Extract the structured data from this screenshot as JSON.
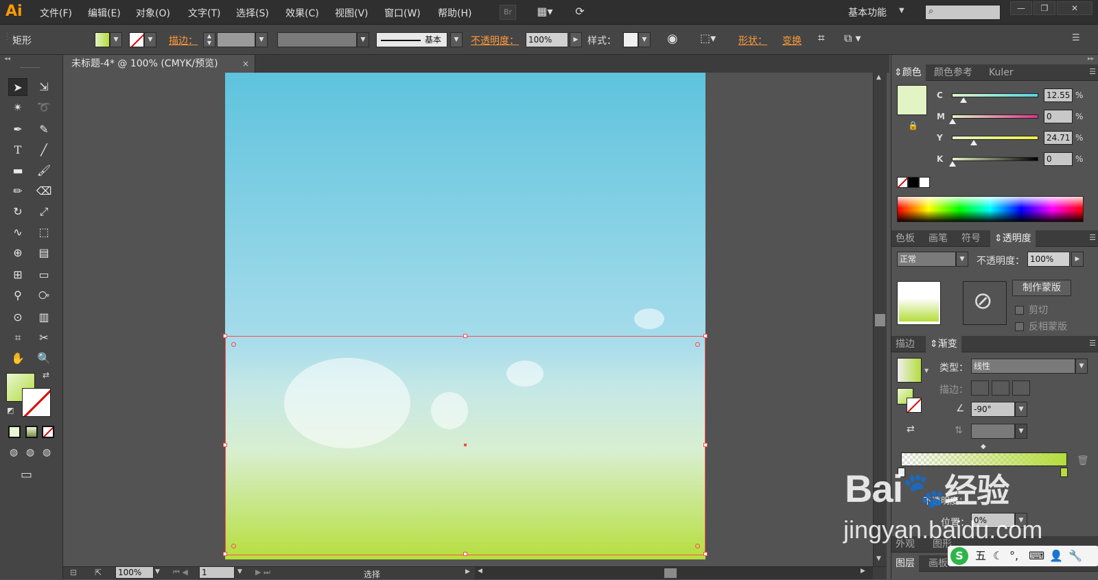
{
  "app": {
    "logo": "Ai",
    "menus": [
      "文件(F)",
      "编辑(E)",
      "对象(O)",
      "文字(T)",
      "选择(S)",
      "效果(C)",
      "视图(V)",
      "窗口(W)",
      "帮助(H)"
    ],
    "bridge_label": "Br",
    "workspace": "基本功能"
  },
  "controlbar": {
    "object_type": "矩形",
    "stroke_label": "描边：",
    "stroke_style": "基本",
    "opacity_label": "不透明度：",
    "opacity_value": "100%",
    "style_label": "样式：",
    "shape_label": "形状：",
    "transform_label": "变换"
  },
  "document": {
    "tab_title": "未标题-4* @ 100% (CMYK/预览)",
    "close_glyph": "×"
  },
  "statusbar": {
    "zoom": "100%",
    "artboard_num": "1",
    "tool_name": "选择"
  },
  "color_panel": {
    "tabs": [
      "颜色",
      "颜色参考",
      "Kuler"
    ],
    "channels": [
      {
        "label": "C",
        "value": "12.55",
        "level": 0.125
      },
      {
        "label": "M",
        "value": "0",
        "level": 0
      },
      {
        "label": "Y",
        "value": "24.71",
        "level": 0.247
      },
      {
        "label": "K",
        "value": "0",
        "level": 0
      }
    ],
    "pct_sign": "%",
    "fill_color": "#e2f3c4"
  },
  "transparency_panel": {
    "tabs": [
      "色板",
      "画笔",
      "符号",
      "透明度"
    ],
    "blend_mode": "正常",
    "opacity_label": "不透明度：",
    "opacity_value": "100%",
    "make_mask_button": "制作蒙版",
    "clip_label": "剪切",
    "invert_label": "反相蒙版"
  },
  "gradient_panel": {
    "tabs": [
      "描边",
      "渐变"
    ],
    "type_label": "类型：",
    "type_value": "线性",
    "stroke_label": "描边：",
    "angle_value": "-90°",
    "opacity_label": "不透明度：",
    "location_label": "位置：",
    "location_value": "0%",
    "end_color": "#b4dc3c"
  },
  "bottom_tabs": [
    "外观",
    "图形",
    "图层",
    "画板"
  ],
  "watermark": {
    "brand": "Bai",
    "brand_cn": "经验",
    "url": "jingyan.baidu.com"
  },
  "ime_bar": {
    "label": "五"
  }
}
